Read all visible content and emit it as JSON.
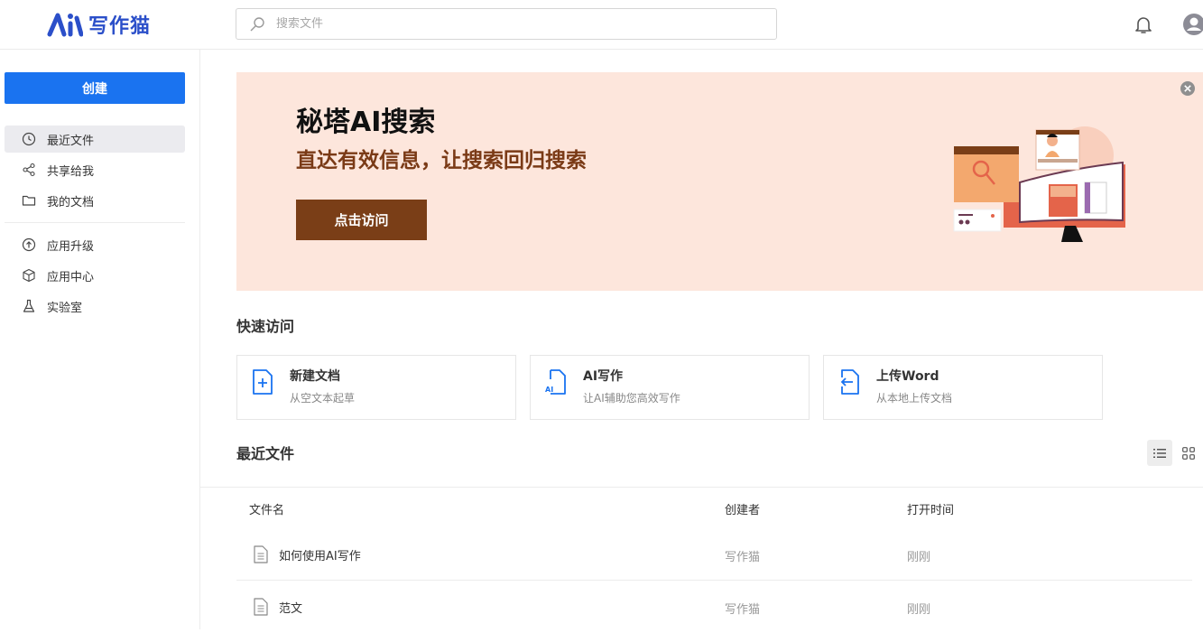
{
  "app": {
    "logo_text": "写作猫"
  },
  "search": {
    "placeholder": "搜索文件"
  },
  "sidebar": {
    "create_label": "创建",
    "items": [
      {
        "label": "最近文件",
        "icon": "clock-icon",
        "active": true
      },
      {
        "label": "共享给我",
        "icon": "share-icon"
      },
      {
        "label": "我的文档",
        "icon": "folder-icon"
      },
      {
        "label": "应用升级",
        "icon": "upgrade-icon"
      },
      {
        "label": "应用中心",
        "icon": "cube-icon"
      },
      {
        "label": "实验室",
        "icon": "flask-icon"
      }
    ]
  },
  "banner": {
    "title": "秘塔AI搜索",
    "subtitle": "直达有效信息，让搜索回归搜索",
    "button_label": "点击访问",
    "background": "#fde6dc",
    "button_color": "#7a3e17"
  },
  "quick_access": {
    "title": "快速访问",
    "cards": [
      {
        "title": "新建文档",
        "desc": "从空文本起草",
        "icon": "new-doc-icon"
      },
      {
        "title": "AI写作",
        "desc": "让AI辅助您高效写作",
        "icon": "ai-doc-icon"
      },
      {
        "title": "上传Word",
        "desc": "从本地上传文档",
        "icon": "upload-doc-icon"
      }
    ]
  },
  "recent": {
    "title": "最近文件",
    "columns": [
      "文件名",
      "创建者",
      "打开时间"
    ],
    "rows": [
      {
        "name": "如何使用AI写作",
        "creator": "写作猫",
        "time": "刚刚"
      },
      {
        "name": "范文",
        "creator": "写作猫",
        "time": "刚刚"
      }
    ]
  },
  "colors": {
    "accent": "#1a73f0",
    "brand": "#2b4fc9"
  }
}
